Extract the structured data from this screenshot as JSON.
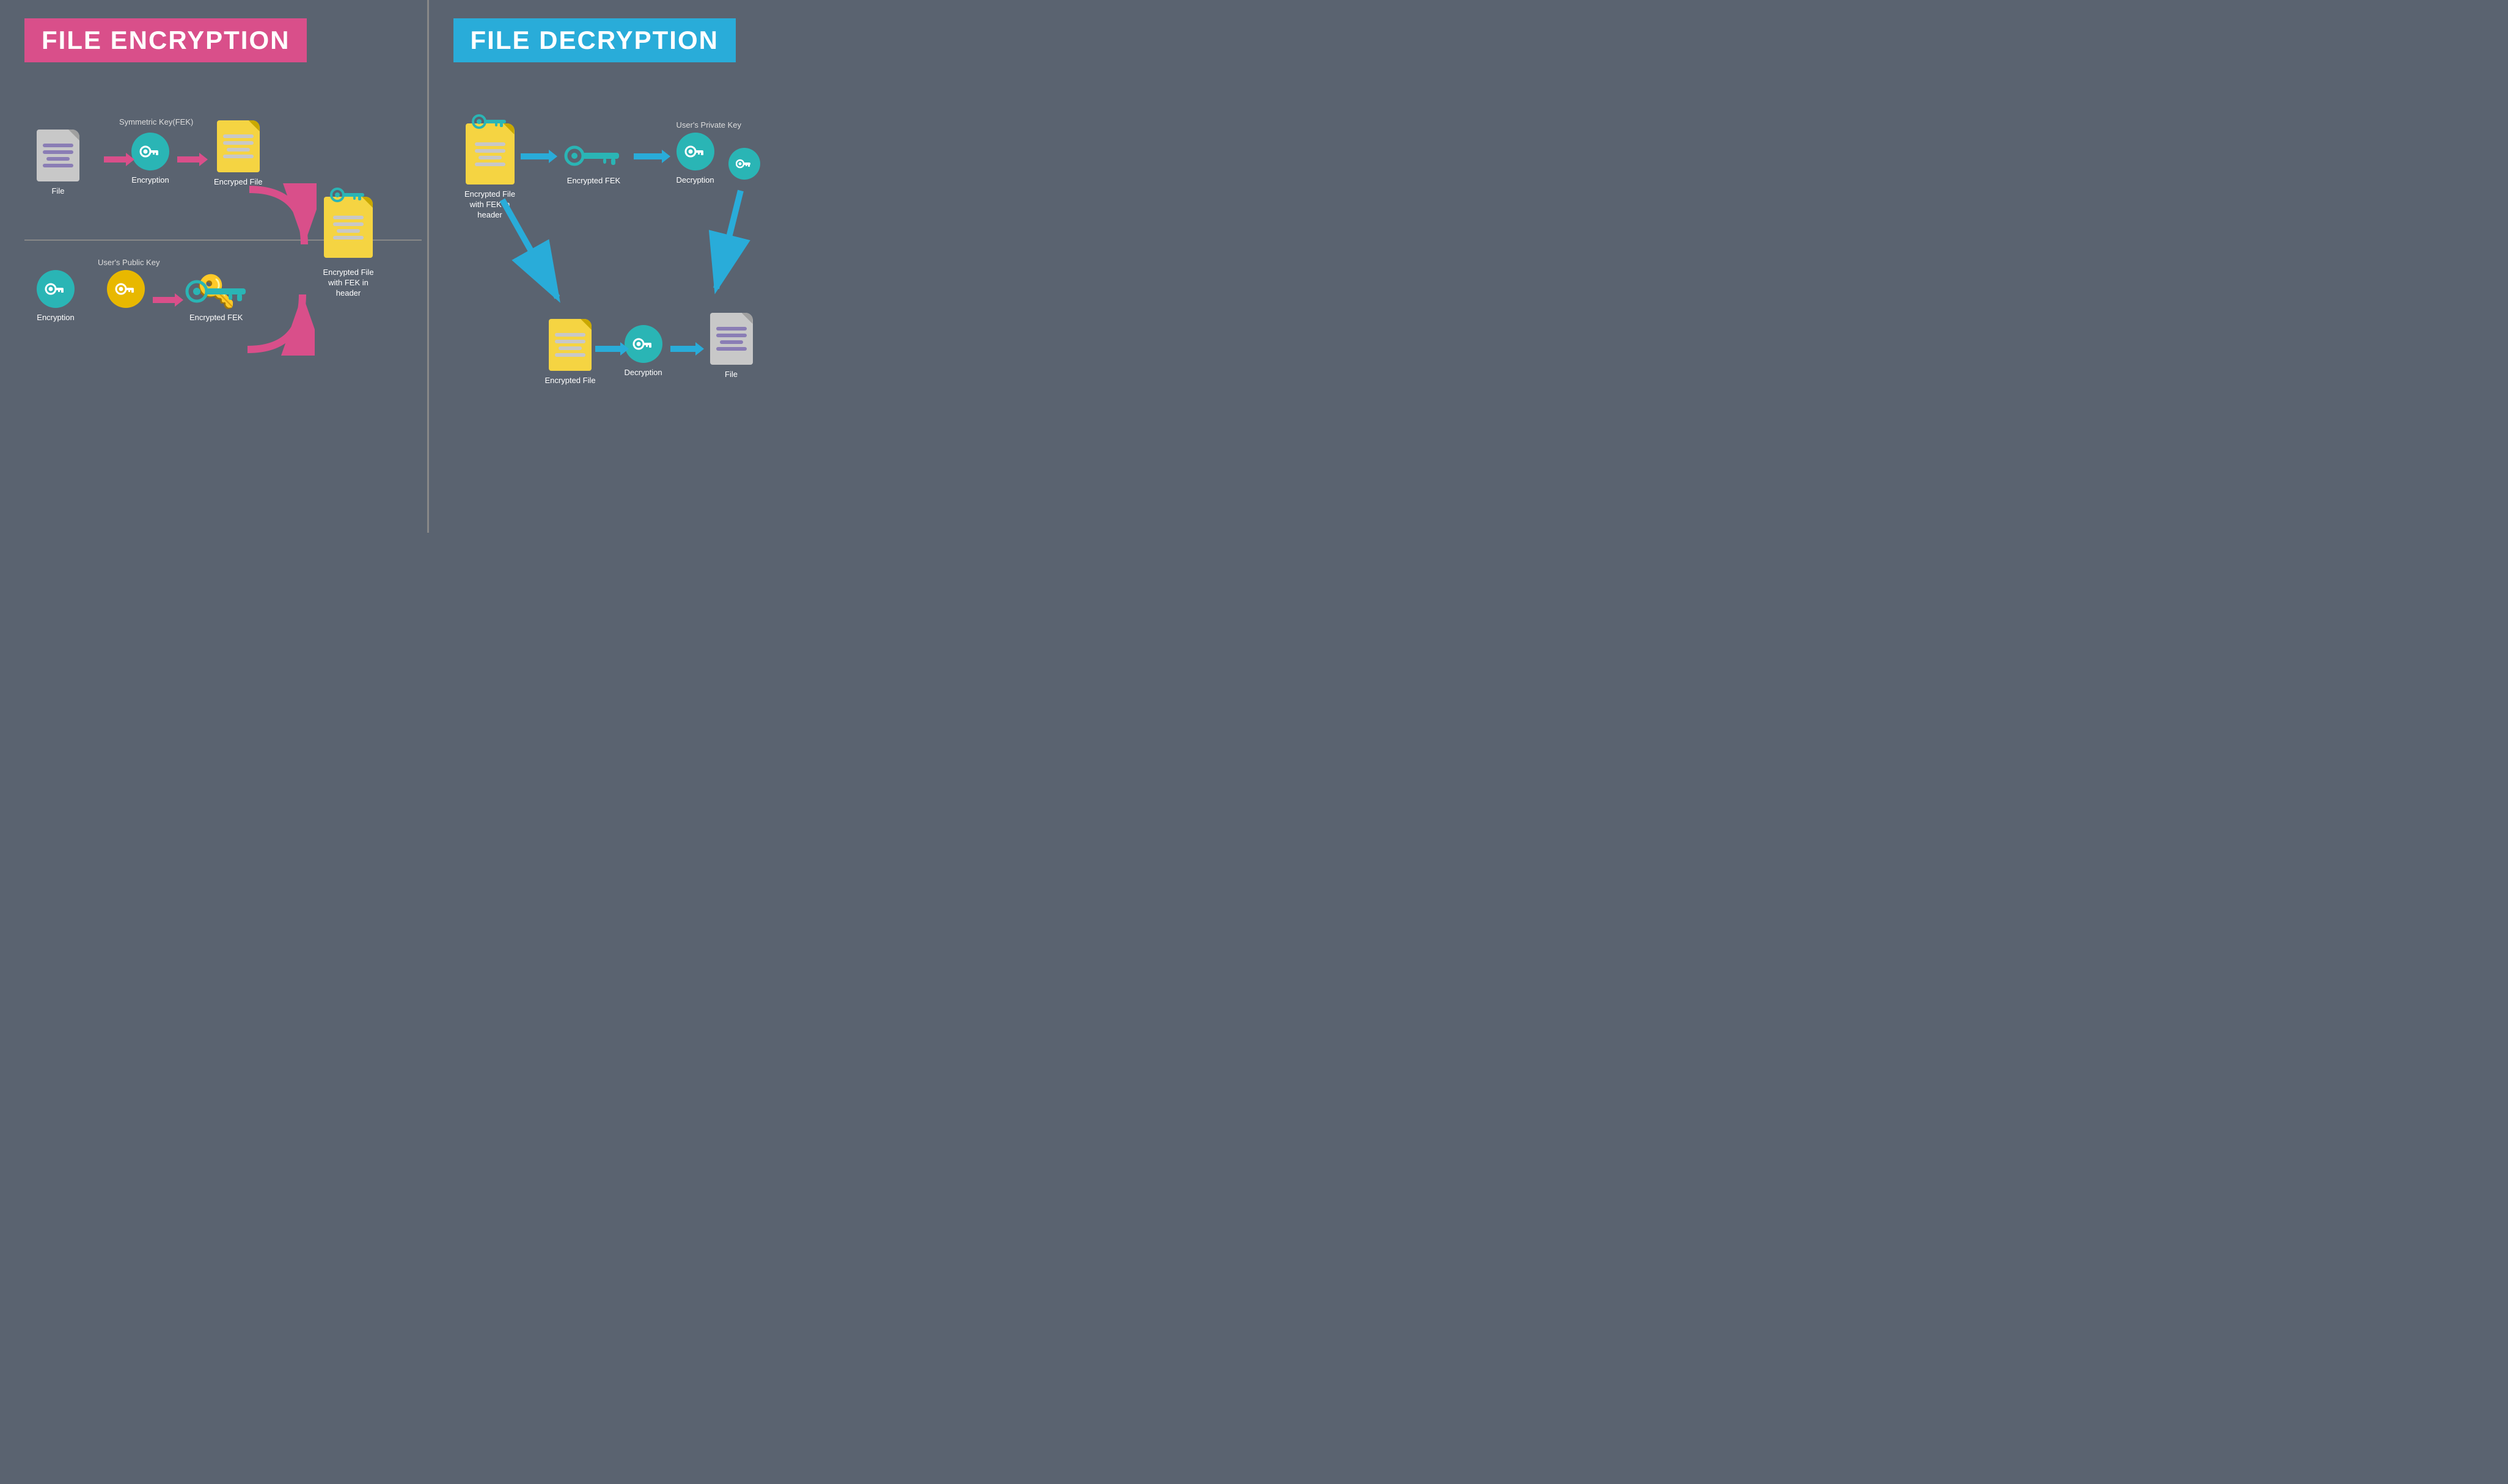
{
  "left": {
    "title": "FILE ENCRYPTION",
    "sections": {
      "top_row": {
        "file_label": "File",
        "sym_key_label": "Symmetric Key(FEK)",
        "encryption_label": "Encryption",
        "encrypted_file_label": "Encryped File"
      },
      "bottom_row": {
        "public_key_label": "User's Public Key",
        "encryption_label": "Encryption",
        "encrypted_fek_label": "Encrypted FEK"
      },
      "result_label": "Encrypted File\nwith FEK in header"
    }
  },
  "right": {
    "title": "FILE DECRYPTION",
    "sections": {
      "top_row": {
        "enc_file_fek_label": "Encrypted File\nwith FEK in header",
        "encrypted_fek_label": "Encrypted FEK",
        "private_key_label": "User's Private Key",
        "decryption_label": "Decryption"
      },
      "bottom_row": {
        "encrypted_file_label": "Encrypted File",
        "decryption_label": "Decryption",
        "file_label": "File"
      }
    }
  },
  "colors": {
    "pink": "#d94f8a",
    "blue": "#29acd9",
    "teal": "#2ab5b5",
    "yellow": "#f5d442",
    "gold": "#e8b800",
    "bg": "#5a6370",
    "white": "#ffffff",
    "gray_doc": "#c8c8d8",
    "purple_line": "#8a7db5"
  }
}
